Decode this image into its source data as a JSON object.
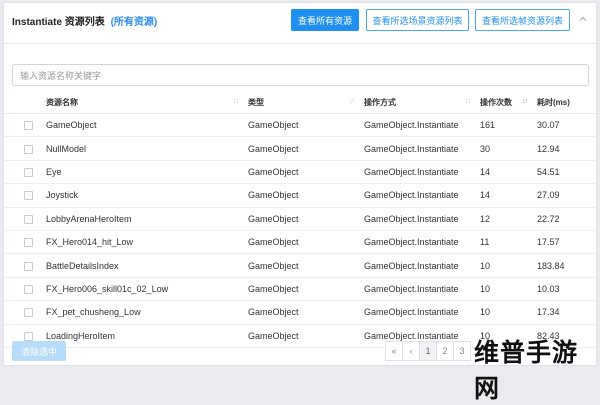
{
  "header": {
    "title": "Instantiate 资源列表",
    "title_link": "(所有资源)",
    "btn_all": "查看所有资源",
    "btn_scene": "查看所选场景资源列表",
    "btn_frame": "查看所选帧资源列表"
  },
  "search": {
    "placeholder": "输入资源名称关键字"
  },
  "table": {
    "columns": [
      "资源名称",
      "类型",
      "操作方式",
      "操作次数",
      "耗时(ms)"
    ],
    "rows": [
      [
        "GameObject",
        "GameObject",
        "GameObject.Instantiate",
        "161",
        "30.07"
      ],
      [
        "NullModel",
        "GameObject",
        "GameObject.Instantiate",
        "30",
        "12.94"
      ],
      [
        "Eye",
        "GameObject",
        "GameObject.Instantiate",
        "14",
        "54.51"
      ],
      [
        "Joystick",
        "GameObject",
        "GameObject.Instantiate",
        "14",
        "27.09"
      ],
      [
        "LobbyArenaHeroItem",
        "GameObject",
        "GameObject.Instantiate",
        "12",
        "22.72"
      ],
      [
        "FX_Hero014_hit_Low",
        "GameObject",
        "GameObject.Instantiate",
        "11",
        "17.57"
      ],
      [
        "BattleDetailsIndex",
        "GameObject",
        "GameObject.Instantiate",
        "10",
        "183.84"
      ],
      [
        "FX_Hero006_skill01c_02_Low",
        "GameObject",
        "GameObject.Instantiate",
        "10",
        "10.03"
      ],
      [
        "FX_pet_chusheng_Low",
        "GameObject",
        "GameObject.Instantiate",
        "10",
        "17.34"
      ],
      [
        "LoadingHeroItem",
        "GameObject",
        "GameObject.Instantiate",
        "10",
        "82.43"
      ]
    ]
  },
  "footer": {
    "clear_btn": "清除选中",
    "pager": {
      "first": "«",
      "prev": "‹",
      "pages": [
        "1",
        "2",
        "3"
      ],
      "current": "1"
    }
  },
  "watermark": "维普手游网",
  "colors": {
    "primary": "#1f8ff0",
    "disabled": "#b7dcfa"
  }
}
